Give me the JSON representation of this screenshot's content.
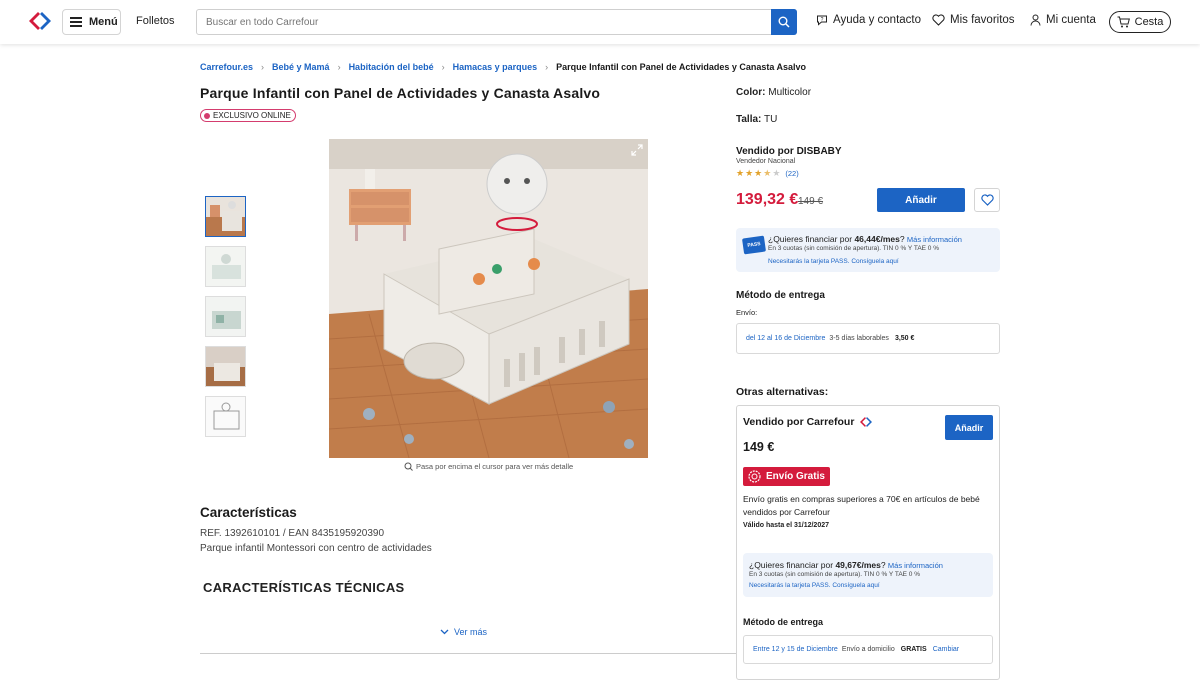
{
  "header": {
    "menu_label": "Menú",
    "folletos_label": "Folletos",
    "search_placeholder": "Buscar en todo Carrefour",
    "help_label": "Ayuda y contacto",
    "favorites_label": "Mis favoritos",
    "account_label": "Mi cuenta",
    "cart_label": "Cesta"
  },
  "breadcrumb": [
    "Carrefour.es",
    "Bebé y Mamá",
    "Habitación del bebé",
    "Hamacas y parques",
    "Parque Infantil con Panel de Actividades y Canasta Asalvo"
  ],
  "product": {
    "title": "Parque Infantil con Panel de Actividades y Canasta Asalvo",
    "badge": "EXCLUSIVO ONLINE",
    "hover_hint": "Pasa por encima el cursor para ver más detalle",
    "characteristics_heading": "Características",
    "ref": "REF. 1392610101 / EAN 8435195920390",
    "description": "Parque infantil Montessori con centro de actividades",
    "tech_heading": "CARACTERÍSTICAS TÉCNICAS",
    "ver_mas": "Ver más"
  },
  "buybox": {
    "color_label": "Color:",
    "color_value": "Multicolor",
    "talla_label": "Talla:",
    "talla_value": "TU",
    "sold_by_prefix": "Vendido por",
    "seller": "DISBABY",
    "seller_type": "Vendedor Nacional",
    "rating": 3.5,
    "reviews": "(22)",
    "price": "139,32 €",
    "old_price": "149 €",
    "add_label": "Añadir",
    "financing": {
      "q": "¿Quieres financiar por ",
      "amount": "46,44€/mes",
      "q_end": "? ",
      "more": "Más información",
      "terms": "En 3 cuotas (sin comisión de apertura). TIN 0 % Y TAE 0 %",
      "card": "Necesitarás la tarjeta PASS. Consíguela aquí",
      "pass_label": "PASS"
    },
    "delivery_heading": "Método de entrega",
    "envio_label": "Envío:",
    "delivery_dates": "del 12 al 16 de Diciembre",
    "delivery_days": "3-5 días laborables",
    "delivery_price": "3,50 €"
  },
  "alternatives": {
    "heading": "Otras alternativas:",
    "seller_line": "Vendido por Carrefour",
    "price": "149 €",
    "add_label": "Añadir",
    "free_shipping": "Envío Gratis",
    "promo": "Envío gratis en compras superiores a 70€ en artículos de bebé vendidos por Carrefour",
    "valid": "Válido hasta el 31/12/2027",
    "financing": {
      "q": "¿Quieres financiar por ",
      "amount": "49,67€/mes",
      "q_end": "? ",
      "more": "Más información",
      "terms": "En 3 cuotas (sin comisión de apertura). TIN 0 % Y TAE 0 %",
      "card": "Necesitarás la tarjeta PASS. Consíguela aquí"
    },
    "delivery_heading": "Método de entrega",
    "delivery_dates": "Entre 12 y 15 de Diciembre",
    "delivery_type": "Envío a domicilio",
    "delivery_price": "GRATIS",
    "change": "Cambiar"
  },
  "colors": {
    "brand_blue": "#1c64c4",
    "price_red": "#d41b3c",
    "badge_pink": "#d43c6e"
  }
}
